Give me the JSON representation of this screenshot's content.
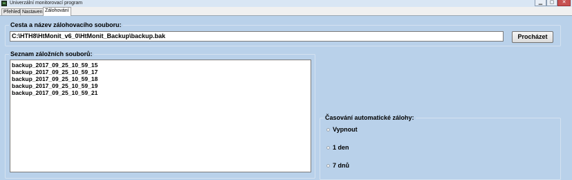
{
  "window": {
    "title": "Univerzální monitorovací program",
    "minimize_symbol": "▁",
    "maximize_symbol": "▢",
    "close_symbol": "✕"
  },
  "tabs": [
    {
      "label": "Přehled"
    },
    {
      "label": "Nastavení"
    },
    {
      "label": "Zálohování"
    }
  ],
  "backup_path": {
    "group_title": "Cesta a název zálohovacího souboru:",
    "value": "C:\\HTH8\\HtMonit_v6_0\\HtMonit_Backup\\backup.bak",
    "browse_label": "Procházet"
  },
  "backup_list": {
    "group_title": "Seznam záložních souborů:",
    "items": [
      "backup_2017_09_25_10_59_15",
      "backup_2017_09_25_10_59_17",
      "backup_2017_09_25_10_59_18",
      "backup_2017_09_25_10_59_19",
      "backup_2017_09_25_10_59_21"
    ]
  },
  "auto_backup": {
    "group_title": "Časování automatické zálohy:",
    "options": [
      {
        "label": "Vypnout"
      },
      {
        "label": "1 den"
      },
      {
        "label": "7 dnů"
      }
    ]
  }
}
